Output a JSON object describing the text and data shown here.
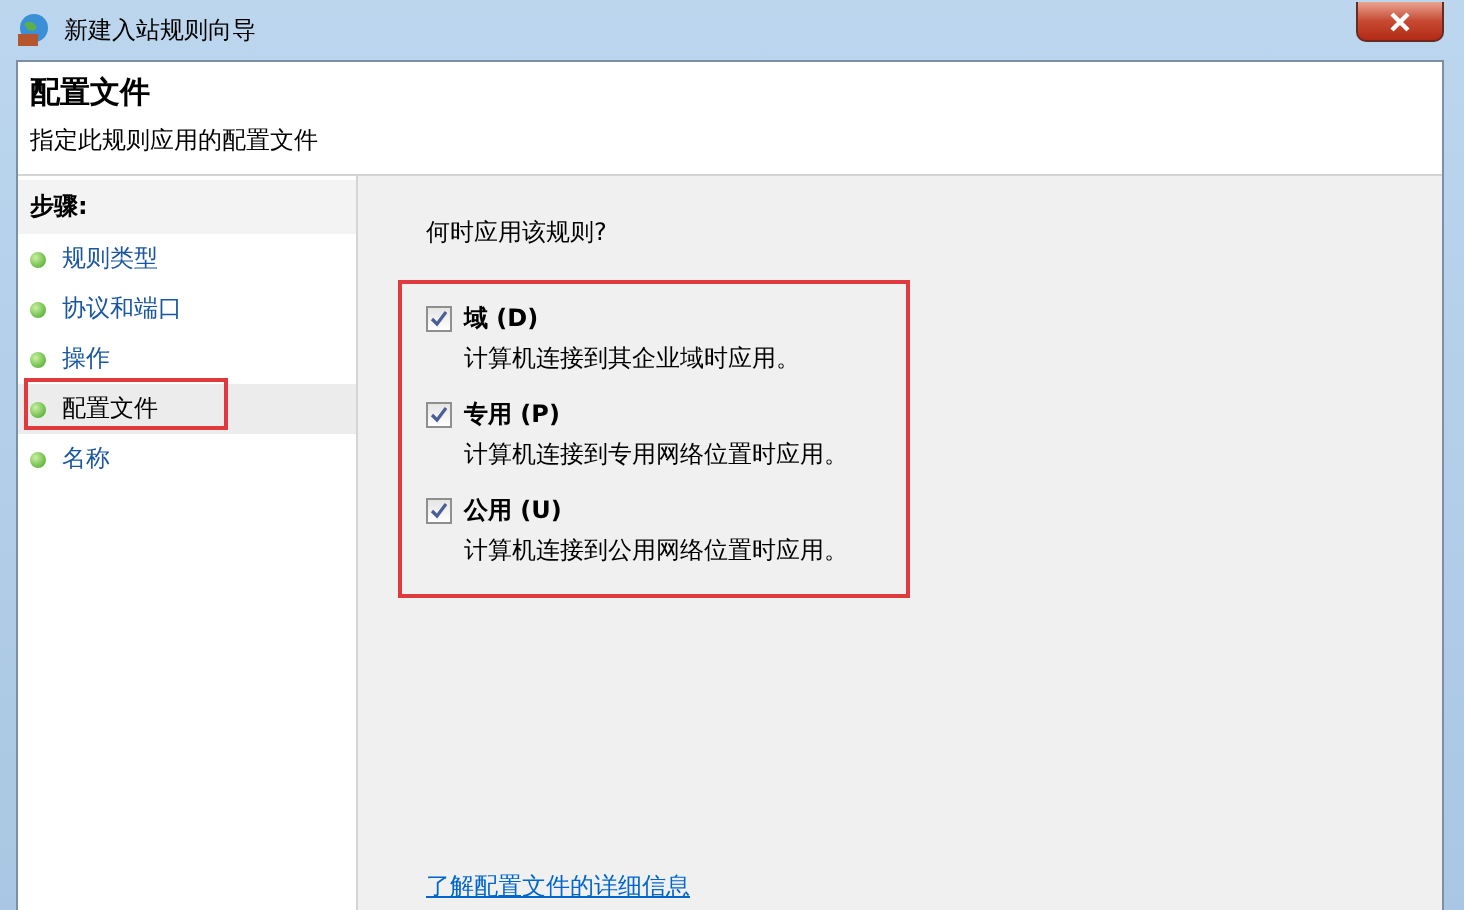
{
  "window": {
    "title": "新建入站规则向导"
  },
  "header": {
    "title": "配置文件",
    "subtitle": "指定此规则应用的配置文件"
  },
  "steps": {
    "heading": "步骤:",
    "items": [
      {
        "label": "规则类型",
        "selected": false
      },
      {
        "label": "协议和端口",
        "selected": false
      },
      {
        "label": "操作",
        "selected": false
      },
      {
        "label": "配置文件",
        "selected": true
      },
      {
        "label": "名称",
        "selected": false
      }
    ]
  },
  "question": "何时应用该规则?",
  "options": [
    {
      "label": "域 (D)",
      "description": "计算机连接到其企业域时应用。",
      "checked": true
    },
    {
      "label": "专用 (P)",
      "description": "计算机连接到专用网络位置时应用。",
      "checked": true
    },
    {
      "label": "公用 (U)",
      "description": "计算机连接到公用网络位置时应用。",
      "checked": true
    }
  ],
  "link": "了解配置文件的详细信息"
}
